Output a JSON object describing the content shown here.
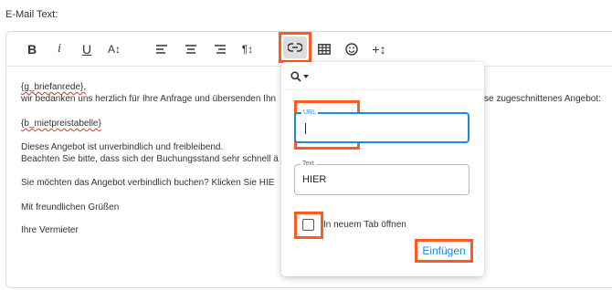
{
  "field": {
    "label": "E-Mail Text:"
  },
  "toolbar": {
    "bold": "B",
    "italic": "i",
    "underline": "U",
    "font_size": "A↕",
    "paragraph": "¶↕",
    "insert_more": "+↕"
  },
  "content": {
    "line1": "{g_briefanrede},",
    "line2a": "wir bedanken uns herzlich für Ihre Anfrage und übersenden Ihn",
    "line2b": "se zugeschnittenes Angebot:",
    "line3": "{b_mietpreistabelle}",
    "line4": "Dieses Angebot ist unverbindlich und freibleibend.",
    "line5": "Beachten Sie bitte, dass sich der Buchungsstand sehr schnell ä",
    "line6": "Sie möchten das Angebot verbindlich buchen? Klicken Sie HIE",
    "line7": "Mit freundlichen Grüßen",
    "line8": "Ihre Vermieter"
  },
  "link_dialog": {
    "url_label": "URL",
    "url_value": "",
    "text_label": "Text",
    "text_value": "HIER",
    "new_tab_label": "In neuem Tab öffnen",
    "new_tab_checked": false,
    "insert_button": "Einfügen"
  },
  "colors": {
    "highlight": "#ff5a1f",
    "accent": "#1e88e5",
    "spellcheck": "#e0352b"
  }
}
